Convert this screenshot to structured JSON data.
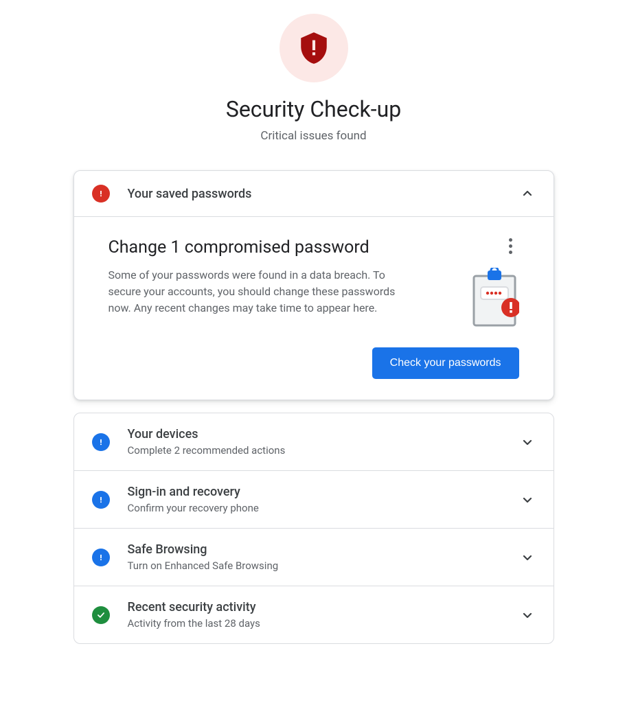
{
  "header": {
    "title": "Security Check-up",
    "subtitle": "Critical issues found"
  },
  "passwords_section": {
    "title": "Your saved passwords",
    "body_title": "Change 1 compromised password",
    "body_desc": "Some of your passwords were found in a data breach. To secure your accounts, you should change these passwords now. Any recent changes may take time to appear here.",
    "button_label": "Check your passwords"
  },
  "sections": [
    {
      "title": "Your devices",
      "subtitle": "Complete 2 recommended actions",
      "status": "blue"
    },
    {
      "title": "Sign-in and recovery",
      "subtitle": "Confirm your recovery phone",
      "status": "blue"
    },
    {
      "title": "Safe Browsing",
      "subtitle": "Turn on Enhanced Safe Browsing",
      "status": "blue"
    },
    {
      "title": "Recent security activity",
      "subtitle": "Activity from the last 28 days",
      "status": "green"
    }
  ]
}
